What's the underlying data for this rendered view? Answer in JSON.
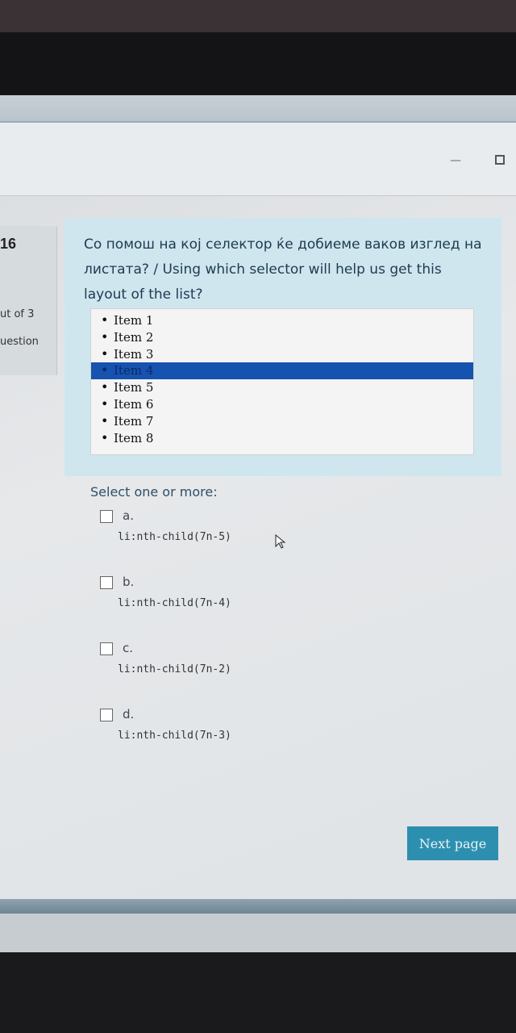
{
  "window": {
    "minimize_glyph": "—"
  },
  "sidebar": {
    "question_number": "16",
    "out_of": "ut of 3",
    "question_label": "uestion"
  },
  "question": {
    "text": "Со помош на кој селектор ќе добиеме ваков изглед на листата? / Using which selector will help us get this layout of the list?",
    "list_items": [
      "Item 1",
      "Item 2",
      "Item 3",
      "Item 4",
      "Item 5",
      "Item 6",
      "Item 7",
      "Item 8"
    ],
    "highlighted_item": "Item 4"
  },
  "answers": {
    "prompt": "Select one or more:",
    "options": [
      {
        "letter": "a.",
        "code": "li:nth-child(7n-5)"
      },
      {
        "letter": "b.",
        "code": "li:nth-child(7n-4)"
      },
      {
        "letter": "c.",
        "code": "li:nth-child(7n-2)"
      },
      {
        "letter": "d.",
        "code": "li:nth-child(7n-3)"
      }
    ]
  },
  "footer": {
    "next_label": "Next page"
  },
  "icons": {
    "cursor": "mouse-cursor-icon",
    "minimize": "minimize-icon",
    "maximize": "maximize-icon"
  },
  "colors": {
    "accent": "#2d8fb0",
    "highlight": "#1652b0",
    "question_bg": "#cfe6ef"
  }
}
